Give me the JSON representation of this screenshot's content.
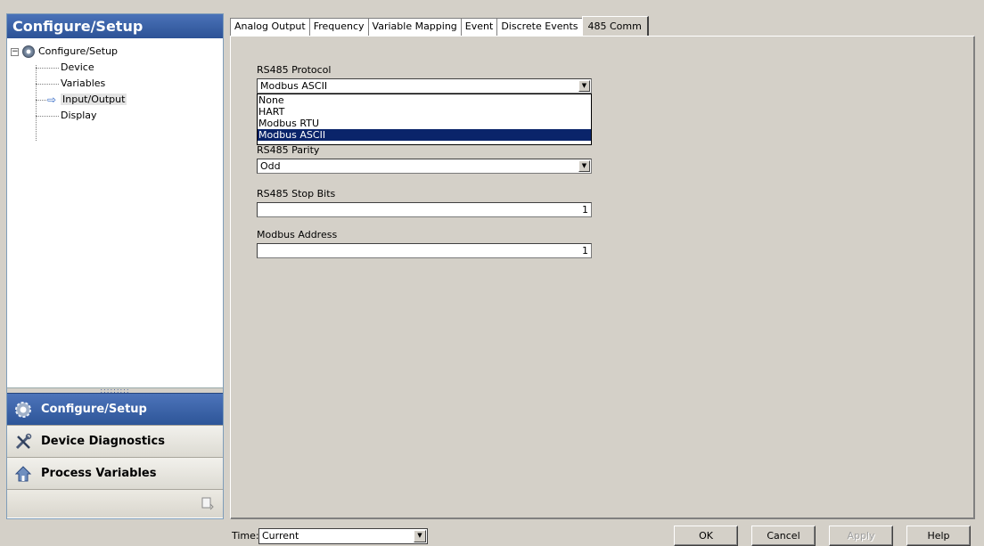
{
  "left_panel": {
    "title": "Configure/Setup",
    "tree": {
      "root": "Configure/Setup",
      "children": [
        "Device",
        "Variables",
        "Input/Output",
        "Display"
      ],
      "selected": "Input/Output"
    },
    "nav": [
      {
        "label": "Configure/Setup",
        "icon": "gear-icon",
        "active": true
      },
      {
        "label": "Device Diagnostics",
        "icon": "tools-icon",
        "active": false
      },
      {
        "label": "Process Variables",
        "icon": "home-icon",
        "active": false
      }
    ]
  },
  "tabs": [
    "Analog Output",
    "Frequency",
    "Variable Mapping",
    "Event",
    "Discrete Events",
    "485 Comm"
  ],
  "active_tab": "485 Comm",
  "form": {
    "protocol_label": "RS485 Protocol",
    "protocol_value": "Modbus ASCII",
    "protocol_options": [
      "None",
      "HART",
      "Modbus RTU",
      "Modbus ASCII"
    ],
    "parity_label": "RS485 Parity",
    "parity_value": "Odd",
    "stop_bits_label": "RS485 Stop Bits",
    "stop_bits_value": "1",
    "address_label": "Modbus Address",
    "address_value": "1"
  },
  "bottom": {
    "time_label": "Time:",
    "time_value": "Current",
    "ok": "OK",
    "cancel": "Cancel",
    "apply": "Apply",
    "help": "Help"
  },
  "colors": {
    "panel_header": "#2c5296",
    "dropdown_selection": "#0a246a",
    "window_bg": "#d4d0c8"
  }
}
